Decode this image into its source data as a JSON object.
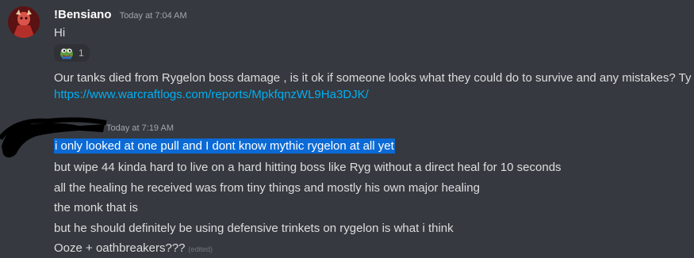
{
  "message1": {
    "username": "!Bensiano",
    "timestamp": "Today at 7:04 AM",
    "line1": "Hi",
    "reaction": {
      "emoji_icon": "pepe-frog-icon",
      "count": "1"
    },
    "line2": "Our tanks died from Rygelon boss damage , is it ok if someone looks what they could do to survive and any mistakes? Ty",
    "link": "https://www.warcraftlogs.com/reports/MpkfqnzWL9Ha3DJK/"
  },
  "message2": {
    "timestamp": "Today at 7:19 AM",
    "lines": [
      "i only looked at one pull and I dont know mythic rygelon at all yet",
      "but wipe 44 kinda hard to live on a hard hitting boss like Ryg without a direct heal for 10 seconds",
      "all the healing he received was from tiny things and mostly his own major healing",
      "the monk that is",
      "but he should definitely be using defensive trinkets on rygelon is what i think",
      "Ooze + oathbreakers???"
    ],
    "edited_label": "(edited)"
  }
}
